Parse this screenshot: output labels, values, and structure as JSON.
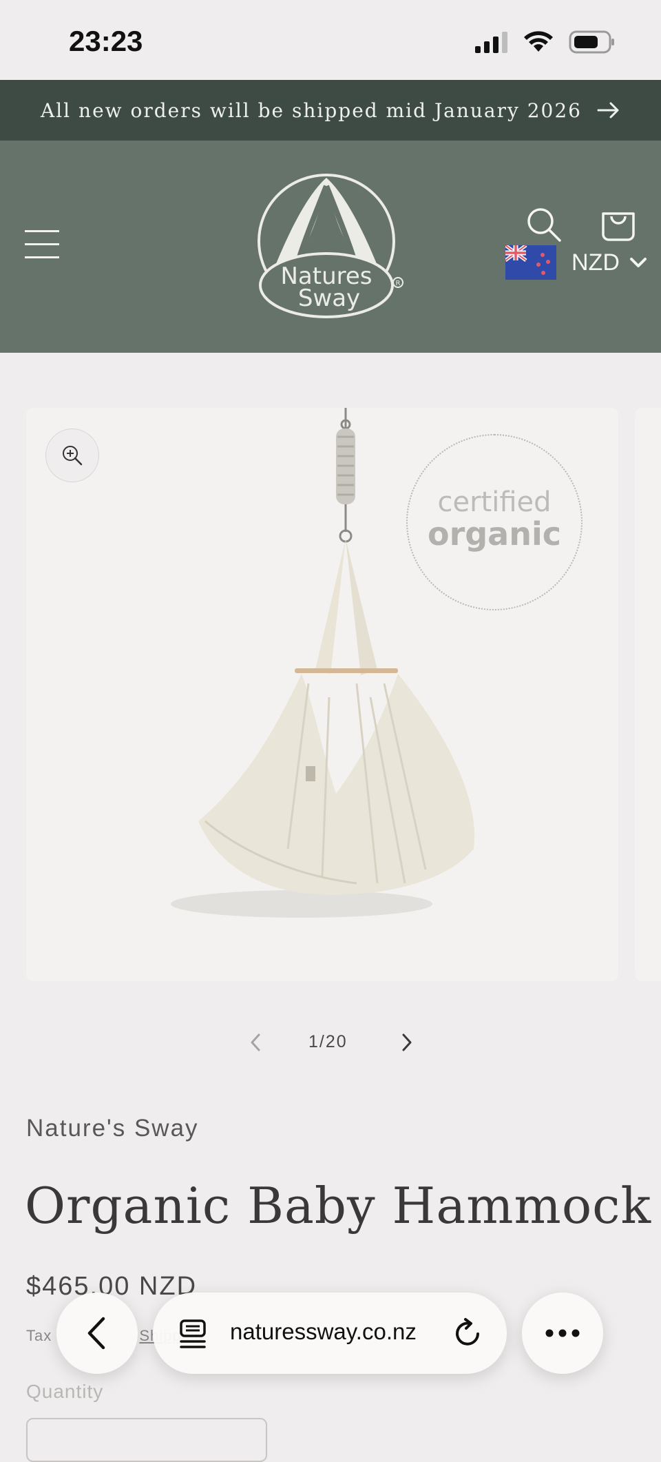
{
  "status_bar": {
    "time": "23:23"
  },
  "announcement": {
    "text": "All new orders will be shipped mid January 2026"
  },
  "header": {
    "logo_text": [
      "Natures",
      "Sway"
    ],
    "currency": {
      "code": "NZD"
    }
  },
  "media": {
    "badge": {
      "line1": "certified",
      "line2": "organic"
    }
  },
  "slider": {
    "counter": "1/20"
  },
  "product": {
    "vendor": "Nature's Sway",
    "title": "Organic Baby Hammock",
    "price": "$465.00 NZD",
    "tax_text": "Tax",
    "shipping_link": "Shipping",
    "quantity_label": "Quantity"
  },
  "browser": {
    "url": "naturessway.co.nz"
  },
  "colors": {
    "announcement_bg": "#3e4b44",
    "header_bg": "#66736a",
    "page_bg": "#efeded"
  }
}
